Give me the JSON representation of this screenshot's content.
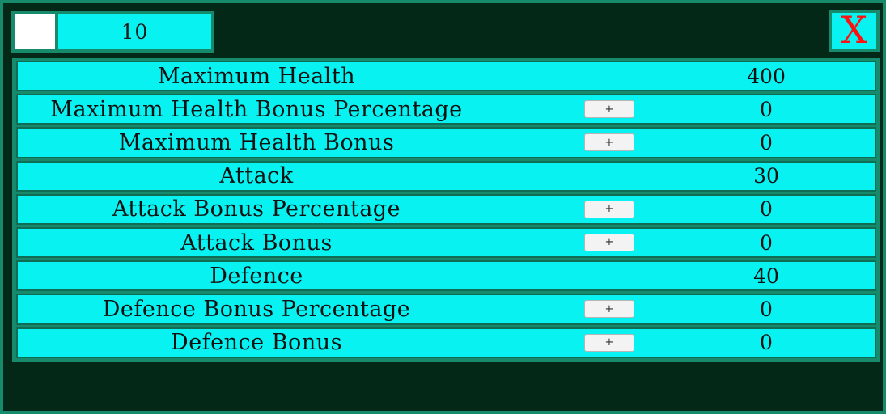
{
  "header": {
    "points": "10",
    "close_label": "X"
  },
  "stats": [
    {
      "label": "Maximum Health",
      "value": "400",
      "has_plus": false
    },
    {
      "label": "Maximum Health Bonus Percentage",
      "value": "0",
      "has_plus": true,
      "plus_label": "+"
    },
    {
      "label": "Maximum Health Bonus",
      "value": "0",
      "has_plus": true,
      "plus_label": "+"
    },
    {
      "label": "Attack",
      "value": "30",
      "has_plus": false
    },
    {
      "label": "Attack Bonus Percentage",
      "value": "0",
      "has_plus": true,
      "plus_label": "+"
    },
    {
      "label": "Attack Bonus",
      "value": "0",
      "has_plus": true,
      "plus_label": "+"
    },
    {
      "label": "Defence",
      "value": "40",
      "has_plus": false
    },
    {
      "label": "Defence Bonus Percentage",
      "value": "0",
      "has_plus": true,
      "plus_label": "+"
    },
    {
      "label": "Defence Bonus",
      "value": "0",
      "has_plus": true,
      "plus_label": "+"
    }
  ],
  "colors": {
    "background": "#032818",
    "panel_border": "#178a6c",
    "row_fill": "#08f2f2",
    "close_glyph": "#ff1010",
    "swatch": "#ffffff"
  }
}
